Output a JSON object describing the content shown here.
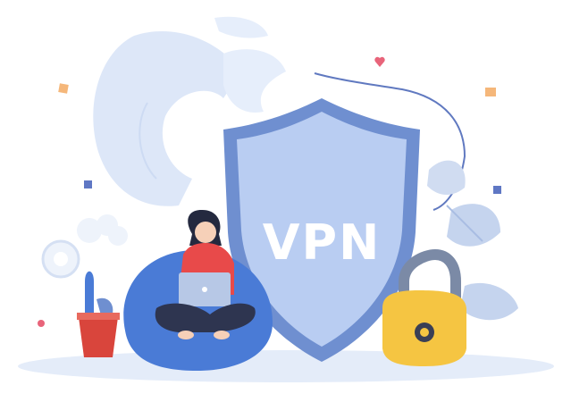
{
  "shield": {
    "label": "VPN"
  },
  "colors": {
    "shield_outer": "#6f8fd0",
    "shield_inner": "#b9cdf2",
    "globe": "#dde7f8",
    "padlock_body": "#f5c542",
    "bean_bag": "#4a7bd6",
    "jacket": "#e84a4a",
    "laptop": "#b7c8e6",
    "leaves": "#c5d4ee",
    "ground": "#e4ecf9"
  },
  "icons": [
    "globe-icon",
    "shield-icon",
    "padlock-icon",
    "laptop-icon",
    "cactus-icon",
    "gear-icon",
    "cloud-icon",
    "heart-icon"
  ]
}
